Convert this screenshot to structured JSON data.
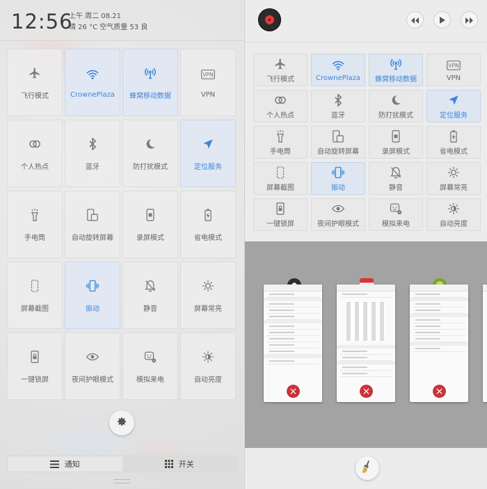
{
  "status": {
    "time": "12:56",
    "date_line1": "上午 周二   08.21",
    "date_line2": "晴   26 °C   空气质量 53   良"
  },
  "left_toggles": [
    {
      "label": "飞行模式",
      "icon": "airplane-icon",
      "on": false
    },
    {
      "label": "CrownePlaza",
      "icon": "wifi-icon",
      "on": true
    },
    {
      "label": "蜂窝移动数据",
      "icon": "cellular-icon",
      "on": true
    },
    {
      "label": "VPN",
      "icon": "vpn-icon",
      "on": false
    },
    {
      "label": "个人热点",
      "icon": "hotspot-icon",
      "on": false
    },
    {
      "label": "蓝牙",
      "icon": "bluetooth-icon",
      "on": false
    },
    {
      "label": "防打扰模式",
      "icon": "moon-icon",
      "on": false
    },
    {
      "label": "定位服务",
      "icon": "location-icon",
      "on": true
    },
    {
      "label": "手电筒",
      "icon": "flashlight-icon",
      "on": false
    },
    {
      "label": "自动旋转屏幕",
      "icon": "rotate-icon",
      "on": false
    },
    {
      "label": "录屏模式",
      "icon": "record-icon",
      "on": false
    },
    {
      "label": "省电模式",
      "icon": "battery-icon",
      "on": false
    },
    {
      "label": "屏幕截图",
      "icon": "screenshot-icon",
      "on": false
    },
    {
      "label": "振动",
      "icon": "vibrate-icon",
      "on": true
    },
    {
      "label": "静音",
      "icon": "mute-icon",
      "on": false
    },
    {
      "label": "屏幕常亮",
      "icon": "brightness-icon",
      "on": false
    },
    {
      "label": "一键锁屏",
      "icon": "lock-icon",
      "on": false
    },
    {
      "label": "夜间护眼模式",
      "icon": "eye-icon",
      "on": false
    },
    {
      "label": "模拟来电",
      "icon": "fake-call-icon",
      "on": false
    },
    {
      "label": "自动亮度",
      "icon": "auto-brightness-icon",
      "on": false
    }
  ],
  "tabs": {
    "notify": "通知",
    "switches": "开关"
  },
  "right_toggles": [
    {
      "label": "飞行模式",
      "icon": "airplane-icon",
      "on": false
    },
    {
      "label": "CrownePlaza",
      "icon": "wifi-icon",
      "on": true
    },
    {
      "label": "蜂窝移动数据",
      "icon": "cellular-icon",
      "on": true
    },
    {
      "label": "VPN",
      "icon": "vpn-icon",
      "on": false
    },
    {
      "label": "个人热点",
      "icon": "hotspot-icon",
      "on": false
    },
    {
      "label": "蓝牙",
      "icon": "bluetooth-icon",
      "on": false
    },
    {
      "label": "防打扰模式",
      "icon": "moon-icon",
      "on": false
    },
    {
      "label": "定位服务",
      "icon": "location-icon",
      "on": true
    },
    {
      "label": "手电筒",
      "icon": "flashlight-icon",
      "on": false
    },
    {
      "label": "自动旋转屏幕",
      "icon": "rotate-icon",
      "on": false
    },
    {
      "label": "录屏模式",
      "icon": "record-icon",
      "on": false
    },
    {
      "label": "省电模式",
      "icon": "battery-icon",
      "on": false
    },
    {
      "label": "屏幕截图",
      "icon": "screenshot-icon",
      "on": false
    },
    {
      "label": "振动",
      "icon": "vibrate-icon",
      "on": true
    },
    {
      "label": "静音",
      "icon": "mute-icon",
      "on": false
    },
    {
      "label": "屏幕常亮",
      "icon": "brightness-icon",
      "on": false
    },
    {
      "label": "一键锁屏",
      "icon": "lock-icon",
      "on": false
    },
    {
      "label": "夜间护眼模式",
      "icon": "eye-icon",
      "on": false
    },
    {
      "label": "模拟来电",
      "icon": "fake-call-icon",
      "on": false
    },
    {
      "label": "自动亮度",
      "icon": "auto-brightness-icon",
      "on": false
    }
  ],
  "media": {
    "prev_icon": "previous-icon",
    "play_icon": "play-icon",
    "next_icon": "next-icon"
  },
  "recents": {
    "close_glyph": "×",
    "cards": [
      {
        "app_icon": "settings-app-icon"
      },
      {
        "app_icon": "toolbox-app-icon"
      },
      {
        "app_icon": "android-app-icon"
      }
    ]
  },
  "colors": {
    "accent": "#3d85d8",
    "active_tile": "#e0e8f3",
    "close_red": "#c9333b"
  }
}
